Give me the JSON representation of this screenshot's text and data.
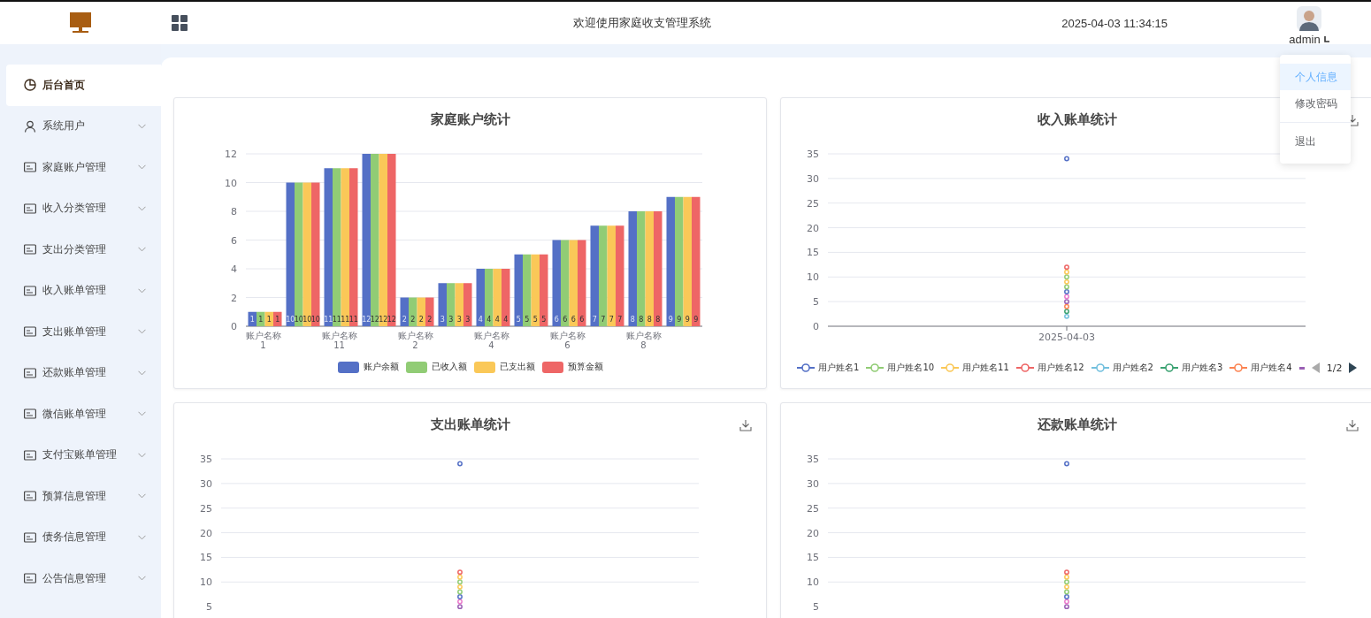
{
  "header": {
    "title": "欢迎使用家庭收支管理系统",
    "datetime": "2025-04-03 11:34:15",
    "user": "admin"
  },
  "user_menu": [
    {
      "label": "个人信息",
      "selected": true,
      "divider_before": false
    },
    {
      "label": "修改密码",
      "selected": false,
      "divider_before": false
    },
    {
      "label": "退出",
      "selected": false,
      "divider_before": true
    }
  ],
  "sidebar": {
    "items": [
      {
        "label": "后台首页",
        "kind": "dashboard",
        "selected": true,
        "expandable": false
      },
      {
        "label": "系统用户",
        "kind": "user",
        "selected": false,
        "expandable": true
      },
      {
        "label": "家庭账户管理",
        "kind": "card",
        "selected": false,
        "expandable": true
      },
      {
        "label": "收入分类管理",
        "kind": "card",
        "selected": false,
        "expandable": true
      },
      {
        "label": "支出分类管理",
        "kind": "card",
        "selected": false,
        "expandable": true
      },
      {
        "label": "收入账单管理",
        "kind": "card",
        "selected": false,
        "expandable": true
      },
      {
        "label": "支出账单管理",
        "kind": "card",
        "selected": false,
        "expandable": true
      },
      {
        "label": "还款账单管理",
        "kind": "card",
        "selected": false,
        "expandable": true
      },
      {
        "label": "微信账单管理",
        "kind": "card",
        "selected": false,
        "expandable": true
      },
      {
        "label": "支付宝账单管理",
        "kind": "card",
        "selected": false,
        "expandable": true
      },
      {
        "label": "预算信息管理",
        "kind": "card",
        "selected": false,
        "expandable": true
      },
      {
        "label": "债务信息管理",
        "kind": "card",
        "selected": false,
        "expandable": true
      },
      {
        "label": "公告信息管理",
        "kind": "card",
        "selected": false,
        "expandable": true
      }
    ]
  },
  "cards": [
    {
      "download_button": false,
      "chart_data": {
        "type": "bar",
        "title": "家庭账户统计",
        "categories": [
          "账户名称1",
          null,
          "账户名称11",
          null,
          "账户名称2",
          null,
          "账户名称4",
          null,
          "账户名称6",
          null,
          "账户名称8",
          null
        ],
        "ylim": [
          0,
          12
        ],
        "yticks": [
          0,
          2,
          4,
          6,
          8,
          10,
          12
        ],
        "grid": true,
        "data_labels": true,
        "legend": "bottom",
        "series": [
          {
            "name": "账户余额",
            "color": "#5470c6",
            "values": [
              1,
              10,
              11,
              12,
              2,
              3,
              4,
              5,
              6,
              7,
              8,
              9
            ]
          },
          {
            "name": "已收入额",
            "color": "#91cc75",
            "values": [
              1,
              10,
              11,
              12,
              2,
              3,
              4,
              5,
              6,
              7,
              8,
              9
            ]
          },
          {
            "name": "已支出额",
            "color": "#fac858",
            "values": [
              1,
              10,
              11,
              12,
              2,
              3,
              4,
              5,
              6,
              7,
              8,
              9
            ]
          },
          {
            "name": "预算金额",
            "color": "#ee6666",
            "values": [
              1,
              10,
              11,
              12,
              2,
              3,
              4,
              5,
              6,
              7,
              8,
              9
            ]
          }
        ]
      }
    },
    {
      "download_button": true,
      "legend_pager": "1/2",
      "chart_data": {
        "type": "line",
        "title": "收入账单统计",
        "x": [
          "2025-04-03"
        ],
        "ylim": [
          0,
          35
        ],
        "yticks": [
          0,
          5,
          10,
          15,
          20,
          25,
          30,
          35
        ],
        "grid": true,
        "legend": "bottom",
        "series": [
          {
            "name": "用户姓名1",
            "marker": "circle",
            "color": "#5470c6",
            "values": [
              34
            ]
          },
          {
            "name": "用户姓名10",
            "marker": "circle",
            "color": "#91cc75",
            "values": [
              10
            ]
          },
          {
            "name": "用户姓名11",
            "marker": "circle",
            "color": "#fac858",
            "values": [
              11
            ]
          },
          {
            "name": "用户姓名12",
            "marker": "circle",
            "color": "#ee6666",
            "values": [
              12
            ]
          },
          {
            "name": "用户姓名2",
            "marker": "circle",
            "color": "#73c0de",
            "values": [
              2
            ]
          },
          {
            "name": "用户姓名3",
            "marker": "circle",
            "color": "#3ba272",
            "values": [
              3
            ]
          },
          {
            "name": "用户姓名4",
            "marker": "circle",
            "color": "#fc8452",
            "values": [
              4
            ]
          },
          {
            "marker": "circle",
            "color": "#9a60b4",
            "values": [
              5
            ]
          },
          {
            "marker": "circle",
            "color": "#ea7ccc",
            "values": [
              6
            ]
          },
          {
            "marker": "circle",
            "color": "#5470c6",
            "values": [
              7
            ]
          },
          {
            "marker": "circle",
            "color": "#91cc75",
            "values": [
              8
            ]
          },
          {
            "marker": "circle",
            "color": "#fac858",
            "values": [
              9
            ]
          }
        ]
      }
    },
    {
      "download_button": true,
      "chart_data": {
        "type": "line",
        "title": "支出账单统计",
        "ylim": [
          5,
          35
        ],
        "yticks": [
          5,
          10,
          15,
          20,
          25,
          30,
          35
        ],
        "grid": true,
        "series": [
          {
            "marker": "circle",
            "color": "#5470c6",
            "values": [
              34
            ]
          },
          {
            "marker": "circle",
            "color": "#91cc75",
            "values": [
              10
            ]
          },
          {
            "marker": "circle",
            "color": "#fac858",
            "values": [
              11
            ]
          },
          {
            "marker": "circle",
            "color": "#ee6666",
            "values": [
              12
            ]
          },
          {
            "marker": "circle",
            "color": "#9a60b4",
            "values": [
              5
            ]
          },
          {
            "marker": "circle",
            "color": "#ea7ccc",
            "values": [
              6
            ]
          },
          {
            "marker": "circle",
            "color": "#5470c6",
            "values": [
              7
            ]
          },
          {
            "marker": "circle",
            "color": "#91cc75",
            "values": [
              8
            ]
          },
          {
            "marker": "circle",
            "color": "#fac858",
            "values": [
              9
            ]
          }
        ]
      }
    },
    {
      "download_button": true,
      "chart_data": {
        "type": "line",
        "title": "还款账单统计",
        "ylim": [
          5,
          35
        ],
        "yticks": [
          5,
          10,
          15,
          20,
          25,
          30,
          35
        ],
        "grid": true,
        "series": [
          {
            "marker": "circle",
            "color": "#5470c6",
            "values": [
              34
            ]
          },
          {
            "marker": "circle",
            "color": "#91cc75",
            "values": [
              10
            ]
          },
          {
            "marker": "circle",
            "color": "#fac858",
            "values": [
              11
            ]
          },
          {
            "marker": "circle",
            "color": "#ee6666",
            "values": [
              12
            ]
          },
          {
            "marker": "circle",
            "color": "#9a60b4",
            "values": [
              5
            ]
          },
          {
            "marker": "circle",
            "color": "#ea7ccc",
            "values": [
              6
            ]
          },
          {
            "marker": "circle",
            "color": "#5470c6",
            "values": [
              7
            ]
          },
          {
            "marker": "circle",
            "color": "#91cc75",
            "values": [
              8
            ]
          },
          {
            "marker": "circle",
            "color": "#fac858",
            "values": [
              9
            ]
          }
        ]
      }
    }
  ]
}
